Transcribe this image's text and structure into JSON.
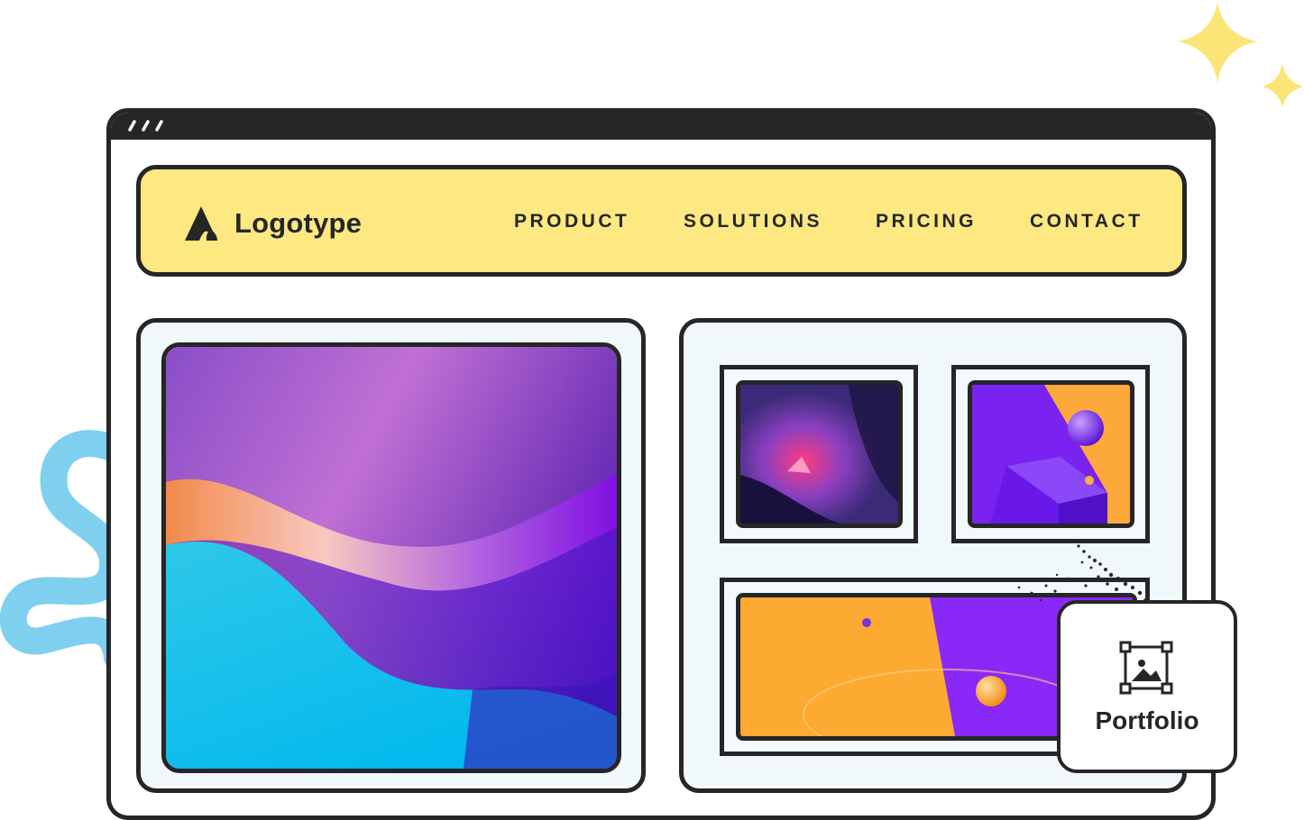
{
  "brand": {
    "name": "Logotype",
    "icon": "logo-mark-icon"
  },
  "nav": {
    "items": [
      {
        "label": "PRODUCT"
      },
      {
        "label": "SOLUTIONS"
      },
      {
        "label": "PRICING"
      },
      {
        "label": "CONTACT"
      }
    ]
  },
  "portfolio_card": {
    "label": "Portfolio",
    "icon": "image-frame-icon"
  },
  "colors": {
    "window_frame": "#262626",
    "nav_background": "#fde882",
    "panel_background": "#f0f8fb",
    "sparkle": "#fbe576",
    "squiggle": "#7fd0ee"
  }
}
